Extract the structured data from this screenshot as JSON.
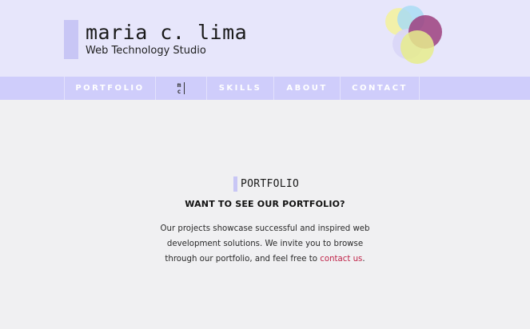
{
  "header": {
    "brand_name": "maria c. lima",
    "tagline": "Web Technology Studio"
  },
  "nav": {
    "items": [
      {
        "label": "PORTFOLIO"
      },
      {
        "label": "SKILLS"
      },
      {
        "label": "ABOUT"
      },
      {
        "label": "CONTACT"
      }
    ],
    "logo_top": "m",
    "logo_bottom": "c"
  },
  "section": {
    "title": "PORTFOLIO",
    "heading": "WANT TO SEE OUR PORTFOLIO?",
    "text_before": "Our projects showcase successful and inspired web development solutions. We invite you to browse through our portfolio, and feel free to",
    "link_text": "contact us",
    "text_after": "."
  },
  "colors": {
    "header_bg": "#e7e6fb",
    "nav_bg": "#cfcdfb",
    "accent_bar": "#c8c6f5",
    "link": "#c0254a",
    "bubble_yellow": "#f3f1a0",
    "bubble_blue": "#a9dcf3",
    "bubble_purple": "#9c3f7e",
    "bubble_lavender": "#d9d6f7"
  }
}
